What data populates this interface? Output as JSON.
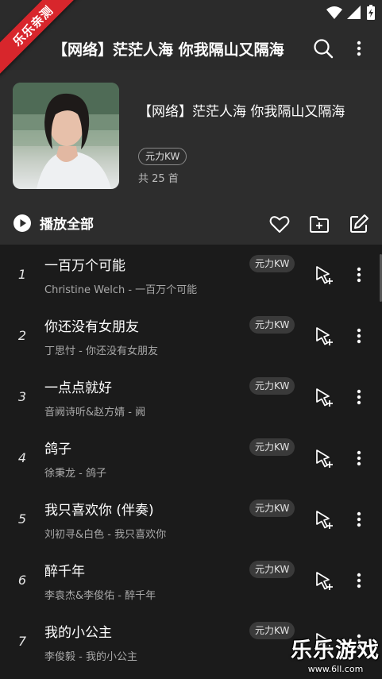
{
  "ribbon": {
    "text": "乐乐亲测"
  },
  "app_bar": {
    "title": "【网络】茫茫人海 你我隔山又隔海",
    "search_icon": "search-icon",
    "more_icon": "more-vert-icon"
  },
  "header": {
    "title": "【网络】茫茫人海 你我隔山又隔海",
    "source_badge": "元力KW",
    "count": "共 25 首"
  },
  "actions": {
    "play_all": "播放全部",
    "icons": [
      "heart-icon",
      "folder-add-icon",
      "edit-icon"
    ]
  },
  "songs": [
    {
      "num": "1",
      "title": "一百万个可能",
      "subtitle": "Christine Welch - 一百万个可能",
      "badge": "元力KW"
    },
    {
      "num": "2",
      "title": "你还没有女朋友",
      "subtitle": "丁思忖 - 你还没有女朋友",
      "badge": "元力KW"
    },
    {
      "num": "3",
      "title": "一点点就好",
      "subtitle": "音阙诗听&赵方婧 - 阙",
      "badge": "元力KW"
    },
    {
      "num": "4",
      "title": "鸽子",
      "subtitle": "徐秉龙 - 鸽子",
      "badge": "元力KW"
    },
    {
      "num": "5",
      "title": "我只喜欢你 (伴奏)",
      "subtitle": "刘初寻&白色 - 我只喜欢你",
      "badge": "元力KW"
    },
    {
      "num": "6",
      "title": "醉千年",
      "subtitle": "李袁杰&李俊佑 - 醉千年",
      "badge": "元力KW"
    },
    {
      "num": "7",
      "title": "我的小公主",
      "subtitle": "李俊毅 - 我的小公主",
      "badge": "元力KW"
    }
  ],
  "watermark": {
    "main": "乐乐游戏",
    "sub": "www.6ll.com"
  },
  "colors": {
    "header_bg": "#2d2d2d",
    "list_bg": "#1b1b1b",
    "ribbon": "#d8262c"
  }
}
